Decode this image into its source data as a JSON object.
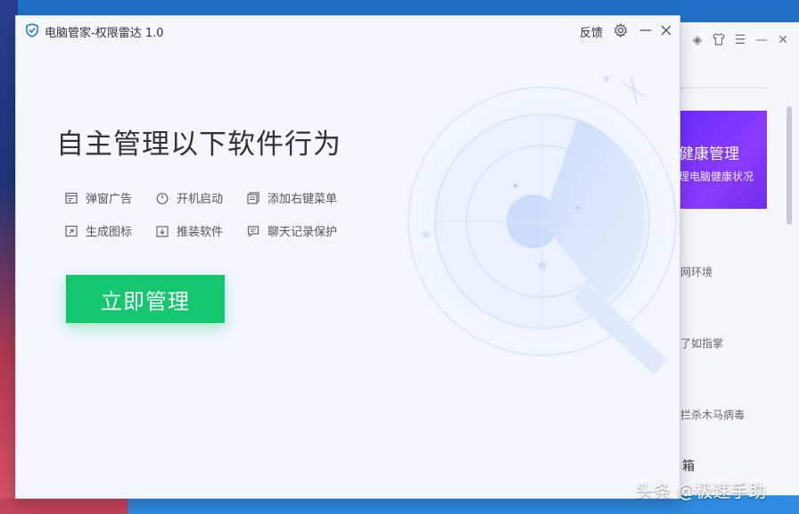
{
  "window": {
    "title": "电脑管家-权限雷达 1.0",
    "feedback_label": "反馈"
  },
  "main": {
    "headline": "自主管理以下软件行为",
    "features": [
      {
        "label": "弹窗广告",
        "icon": "popup-ad-icon"
      },
      {
        "label": "开机启动",
        "icon": "power-icon"
      },
      {
        "label": "添加右键菜单",
        "icon": "context-menu-icon"
      },
      {
        "label": "生成图标",
        "icon": "shortcut-icon"
      },
      {
        "label": "推装软件",
        "icon": "download-install-icon"
      },
      {
        "label": "聊天记录保护",
        "icon": "chat-icon"
      }
    ],
    "cta_label": "立即管理"
  },
  "background_window": {
    "banner_title": "健康管理",
    "banner_subtitle": "理电脑健康状况",
    "items": [
      "网环境",
      "了如指掌",
      "拦杀木马病毒"
    ],
    "toolbox_label": "箱"
  },
  "watermark": "头条 @极速手助",
  "colors": {
    "accent_green": "#12c76d",
    "window_bg": "#f4f7fe",
    "banner_purple": "#7a32ff",
    "logo_blue": "#1f7be0"
  }
}
